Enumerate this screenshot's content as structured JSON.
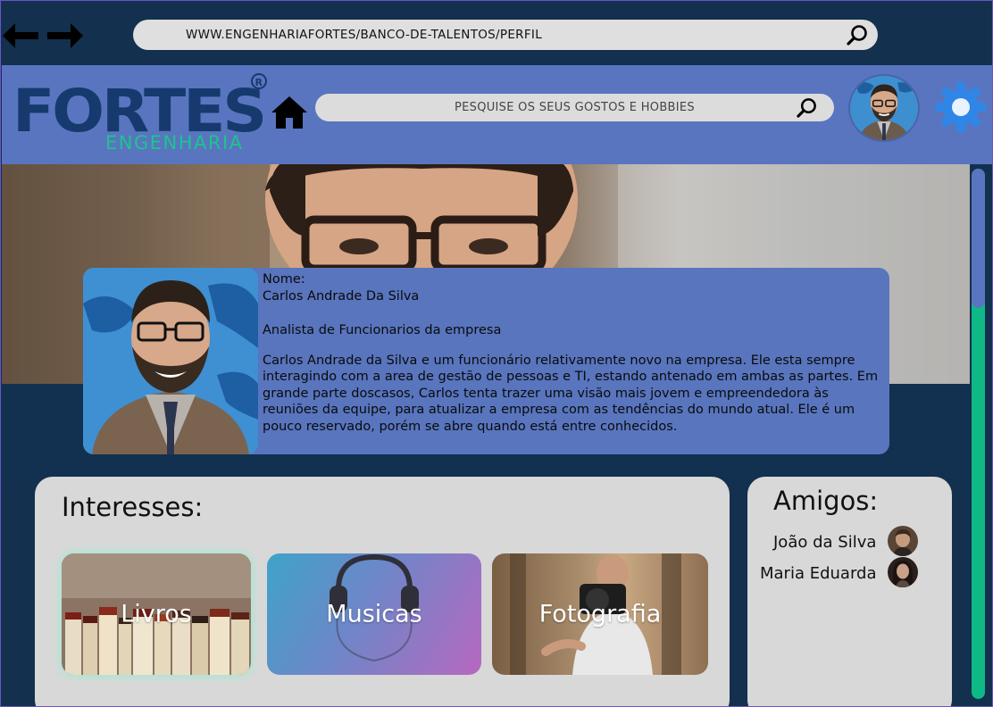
{
  "browser": {
    "url": "WWW.ENGENHARIAFORTES/BANCO-DE-TALENTOS/PERFIL",
    "back_icon": "arrow-left-icon",
    "forward_icon": "arrow-right-icon",
    "search_icon": "search-icon"
  },
  "header": {
    "logo_main": "FORTES",
    "logo_sub": "ENGENHARIA",
    "logo_mark": "®",
    "home_icon": "home-icon",
    "search_placeholder": "PESQUISE OS SEUS GOSTOS E HOBBIES",
    "settings_icon": "gear-icon",
    "brand_color": "#5975bf",
    "accent_color": "#0fb985"
  },
  "profile": {
    "name_label": "Nome:",
    "name": "Carlos Andrade Da Silva",
    "role": "Analista de Funcionarios da empresa",
    "bio": "Carlos Andrade da Silva e um funcionário relativamente novo na empresa. Ele esta sempre interagindo com a area de gestão de pessoas e TI, estando antenado em ambas as partes. Em grande parte doscasos, Carlos tenta trazer uma visão mais jovem e empreendedora às reuniões da equipe, para atualizar a empresa com as tendências do mundo atual. Ele é um pouco reservado, porém se abre quando está entre conhecidos."
  },
  "interests": {
    "title": "Interesses:",
    "items": [
      {
        "label": "Livros"
      },
      {
        "label": "Musicas"
      },
      {
        "label": "Fotografia"
      }
    ]
  },
  "friends": {
    "title": "Amigos:",
    "items": [
      {
        "name": "João da Silva"
      },
      {
        "name": "Maria Eduarda"
      }
    ]
  }
}
